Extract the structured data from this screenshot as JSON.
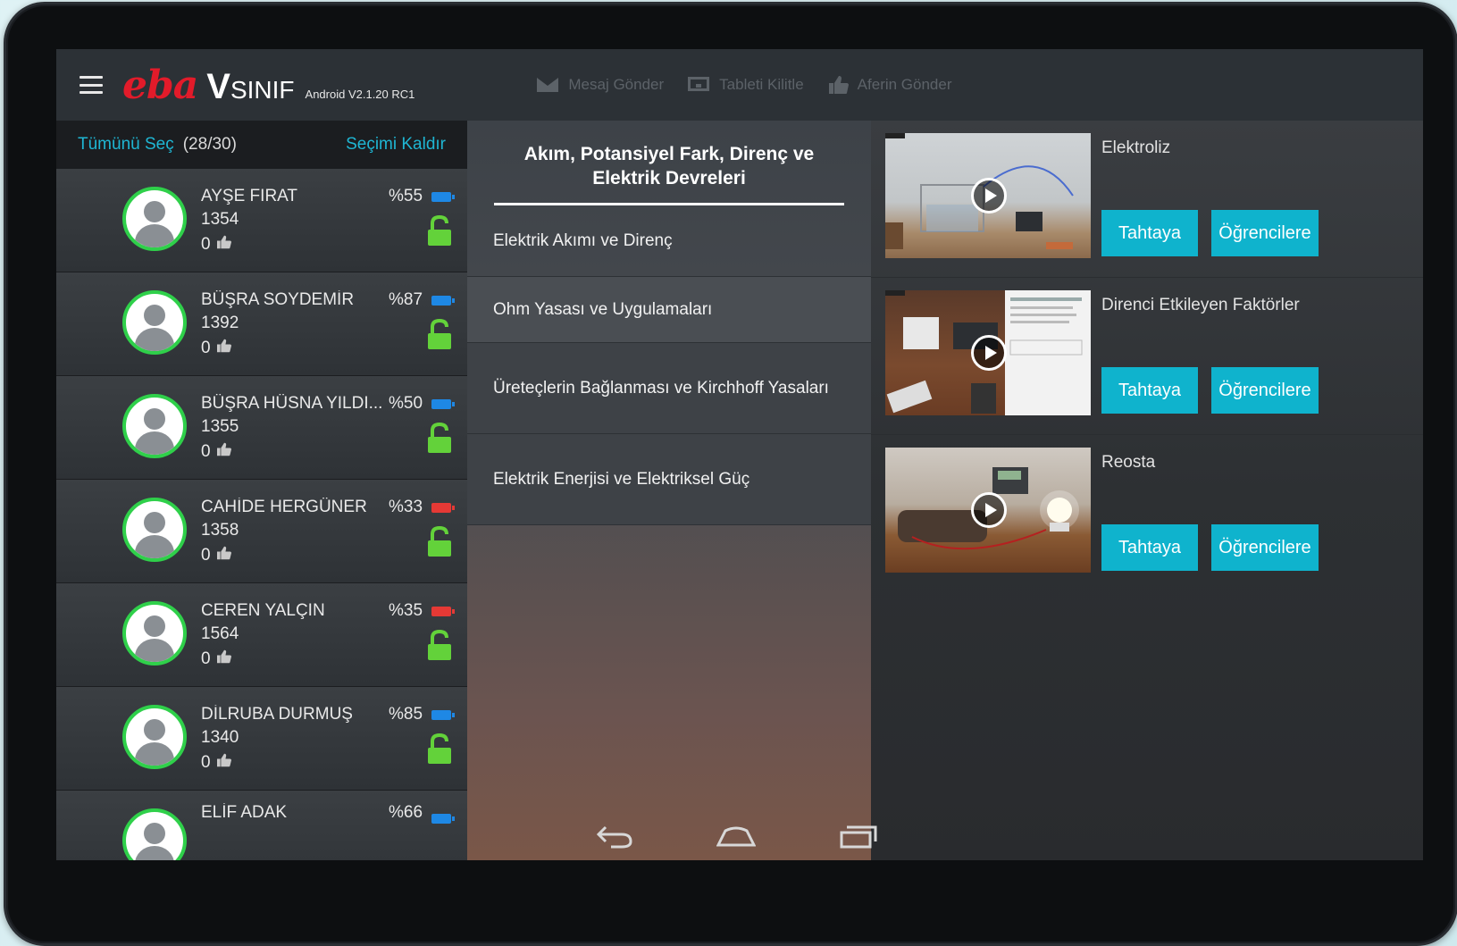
{
  "app": {
    "logo_eba": "eba",
    "logo_v": "V",
    "logo_sinif": "SINIF",
    "version": "Android V2.1.20 RC1"
  },
  "topbar": {
    "actions": [
      {
        "label": "Mesaj Gönder",
        "icon": "envelope-icon"
      },
      {
        "label": "Tableti Kilitle",
        "icon": "tablet-lock-icon"
      },
      {
        "label": "Aferin Gönder",
        "icon": "thumbs-up-icon"
      }
    ]
  },
  "selection": {
    "select_all": "Tümünü Seç",
    "count": "(28/30)",
    "clear": "Seçimi Kaldır"
  },
  "students": [
    {
      "name": "AYŞE FIRAT",
      "number": "1354",
      "likes": "0",
      "percent": "%55",
      "battery_color": "#1e88e5"
    },
    {
      "name": "BÜŞRA SOYDEMİR",
      "number": "1392",
      "likes": "0",
      "percent": "%87",
      "battery_color": "#1e88e5"
    },
    {
      "name": "BÜŞRA HÜSNA YILDI...",
      "number": "1355",
      "likes": "0",
      "percent": "%50",
      "battery_color": "#1e88e5"
    },
    {
      "name": "CAHİDE HERGÜNER",
      "number": "1358",
      "likes": "0",
      "percent": "%33",
      "battery_color": "#e53935"
    },
    {
      "name": "CEREN YALÇIN",
      "number": "1564",
      "likes": "0",
      "percent": "%35",
      "battery_color": "#e53935"
    },
    {
      "name": "DİLRUBA DURMUŞ",
      "number": "1340",
      "likes": "0",
      "percent": "%85",
      "battery_color": "#1e88e5"
    },
    {
      "name": "ELİF ADAK",
      "number": "",
      "likes": "",
      "percent": "%66",
      "battery_color": "#1e88e5"
    }
  ],
  "topics": {
    "title": "Akım, Potansiyel Fark, Direnç ve Elektrik Devreleri",
    "items": [
      "Elektrik Akımı ve Direnç",
      "Ohm Yasası ve Uygulamaları",
      "Üreteçlerin Bağlanması ve Kirchhoff Yasaları",
      "Elektrik Enerjisi ve Elektriksel Güç"
    ]
  },
  "videos": [
    {
      "title": "Elektroliz",
      "board_button": "Tahtaya",
      "students_button": "Öğrencilere"
    },
    {
      "title": "Direnci Etkileyen Faktörler",
      "board_button": "Tahtaya",
      "students_button": "Öğrencilere"
    },
    {
      "title": "Reosta",
      "board_button": "Tahtaya",
      "students_button": "Öğrencilere"
    }
  ],
  "colors": {
    "accent": "#0fb3cd",
    "online_ring": "#2fd04a",
    "lock": "#63d23a",
    "brand_red": "#e21b2a"
  }
}
